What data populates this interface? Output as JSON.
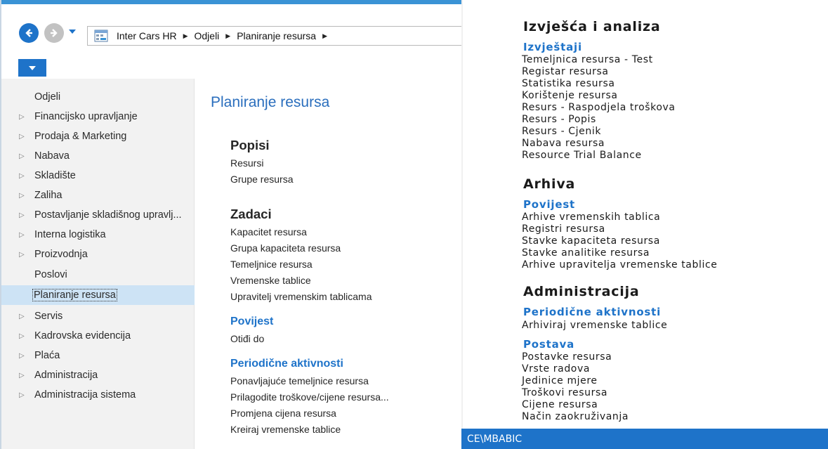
{
  "breadcrumb": [
    "Inter Cars HR",
    "Odjeli",
    "Planiranje resursa"
  ],
  "colors": {
    "accent": "#1e73c9",
    "title_blue": "#2a6ebd",
    "sidebar_bg": "#f2f2f2",
    "selected_bg": "#cde3f5",
    "status_bar": "#1e73c9"
  },
  "icons": {
    "back": "back-arrow-icon",
    "forward": "forward-arrow-icon",
    "dropdown": "chevron-down-icon",
    "address": "page-grid-icon",
    "expand": "expand-triangle-icon"
  },
  "sidebar": {
    "items": [
      {
        "label": "Odjeli",
        "expandable": false
      },
      {
        "label": "Financijsko upravljanje",
        "expandable": true
      },
      {
        "label": "Prodaja & Marketing",
        "expandable": true
      },
      {
        "label": "Nabava",
        "expandable": true
      },
      {
        "label": "Skladište",
        "expandable": true
      },
      {
        "label": "Zaliha",
        "expandable": true
      },
      {
        "label": "Postavljanje skladišnog upravlj...",
        "expandable": true
      },
      {
        "label": "Interna logistika",
        "expandable": true
      },
      {
        "label": "Proizvodnja",
        "expandable": true
      },
      {
        "label": "Poslovi",
        "expandable": false
      },
      {
        "label": "Planiranje resursa",
        "expandable": false,
        "selected": true
      },
      {
        "label": "Servis",
        "expandable": true
      },
      {
        "label": "Kadrovska evidencija",
        "expandable": true
      },
      {
        "label": "Plaća",
        "expandable": true
      },
      {
        "label": "Administracija",
        "expandable": true
      },
      {
        "label": "Administracija sistema",
        "expandable": true
      }
    ]
  },
  "main": {
    "title": "Planiranje resursa",
    "popisi": {
      "heading": "Popisi",
      "links": [
        "Resursi",
        "Grupe resursa"
      ]
    },
    "zadaci": {
      "heading": "Zadaci",
      "links": [
        "Kapacitet resursa",
        "Grupa kapaciteta resursa",
        "Temeljnice resursa",
        "Vremenske tablice",
        "Upravitelj vremenskim tablicama"
      ],
      "povijest": {
        "heading": "Povijest",
        "links": [
          "Otiđi do"
        ]
      },
      "periodicne": {
        "heading": "Periodične aktivnosti",
        "links": [
          "Ponavljajuće temeljnice resursa",
          "Prilagodite troškove/cijene resursa...",
          "Promjena cijena resursa",
          "Kreiraj vremenske tablice"
        ]
      }
    }
  },
  "right": {
    "izvjesca": {
      "heading": "Izvješća i analiza",
      "sub": "Izvještaji",
      "links": [
        "Temeljnica resursa - Test",
        "Registar resursa",
        "Statistika resursa",
        "Korištenje resursa",
        "Resurs - Raspodjela troškova",
        "Resurs - Popis",
        "Resurs - Cjenik",
        "Nabava resursa",
        "Resource Trial Balance"
      ]
    },
    "arhiva": {
      "heading": "Arhiva",
      "sub": "Povijest",
      "links": [
        "Arhive vremenskih tablica",
        "Registri resursa",
        "Stavke kapaciteta resursa",
        "Stavke analitike resursa",
        "Arhive upravitelja vremenske tablice"
      ]
    },
    "administracija": {
      "heading": "Administracija",
      "periodicne": {
        "sub": "Periodične aktivnosti",
        "links": [
          "Arhiviraj vremenske tablice"
        ]
      },
      "postava": {
        "sub": "Postava",
        "links": [
          "Postavke resursa",
          "Vrste radova",
          "Jedinice mjere",
          "Troškovi resursa",
          "Cijene resursa",
          "Način zaokruživanja"
        ]
      }
    },
    "status_user": "CE\\MBABIC"
  }
}
